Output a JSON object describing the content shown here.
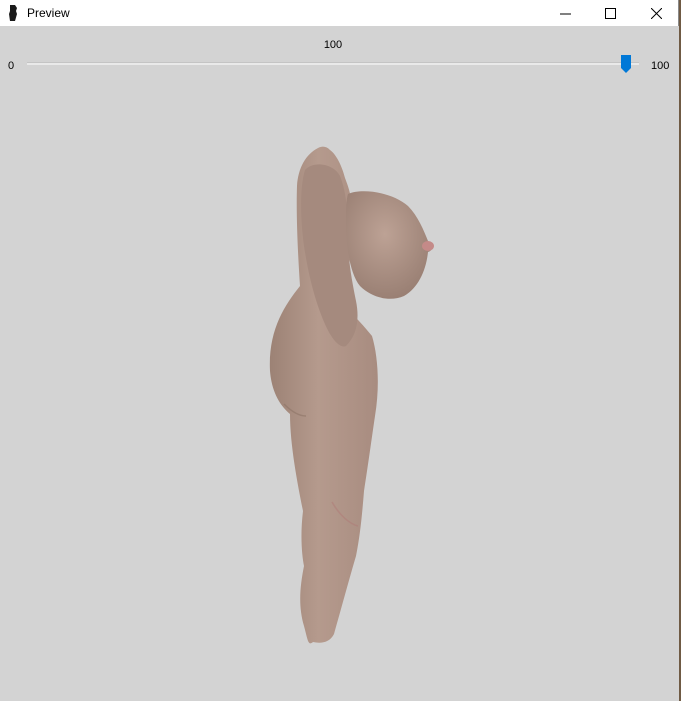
{
  "window": {
    "title": "Preview",
    "icon": "app-figure-icon",
    "controls": [
      "minimize-icon",
      "maximize-icon",
      "close-icon"
    ]
  },
  "slider": {
    "value_label": "100",
    "min_label": "0",
    "max_label": "100",
    "value": 100,
    "min": 0,
    "max": 100,
    "thumb_color": "#0078d7"
  },
  "colors": {
    "background": "#d3d3d3",
    "titlebar": "#ffffff",
    "skin": "#b59a8d"
  }
}
